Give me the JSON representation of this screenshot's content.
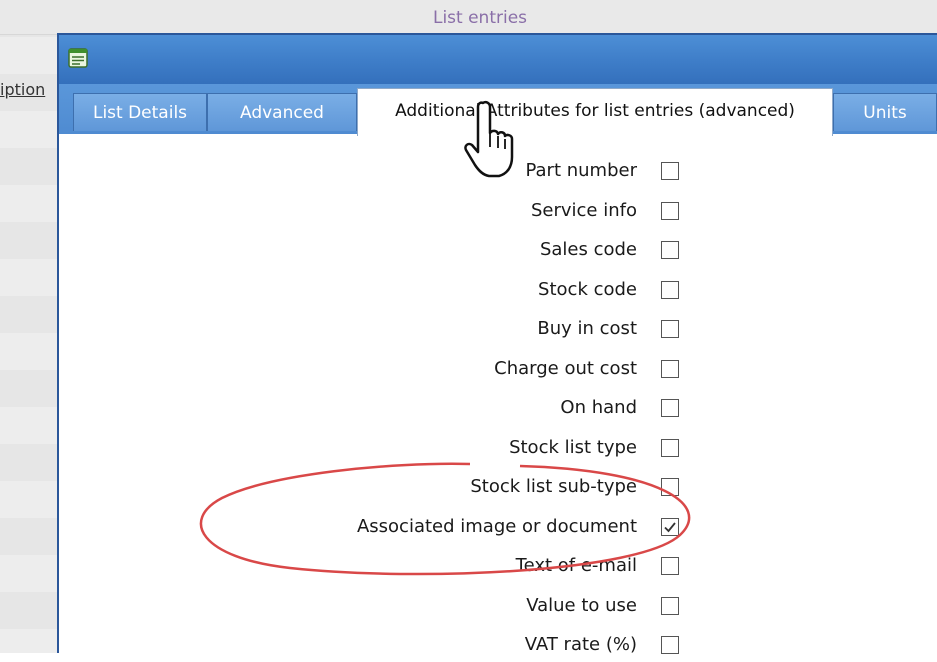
{
  "background_window": {
    "title": "List entries",
    "column_header": "iption"
  },
  "dialog": {
    "tabs": [
      {
        "label": "List Details",
        "active": false
      },
      {
        "label": "Advanced",
        "active": false
      },
      {
        "label": "Additional Attributes for list entries (advanced)",
        "active": true
      },
      {
        "label": "Units",
        "active": false
      }
    ],
    "attributes": [
      {
        "label": "Part number",
        "checked": false
      },
      {
        "label": "Service info",
        "checked": false
      },
      {
        "label": "Sales code",
        "checked": false
      },
      {
        "label": "Stock code",
        "checked": false
      },
      {
        "label": "Buy in cost",
        "checked": false
      },
      {
        "label": "Charge out cost",
        "checked": false
      },
      {
        "label": "On hand",
        "checked": false
      },
      {
        "label": "Stock list type",
        "checked": false
      },
      {
        "label": "Stock list sub-type",
        "checked": false
      },
      {
        "label": "Associated image or document",
        "checked": true
      },
      {
        "label": "Text of e-mail",
        "checked": false
      },
      {
        "label": "Value to use",
        "checked": false
      },
      {
        "label": "VAT rate (%)",
        "checked": false
      }
    ]
  },
  "colors": {
    "titlebar": "#3e7dc8",
    "tab_inactive": "#6aa1de",
    "highlight": "#d94848"
  },
  "icons": {
    "app": "list-window-icon",
    "cursor": "hand-pointer-icon",
    "check": "checkmark-icon"
  }
}
